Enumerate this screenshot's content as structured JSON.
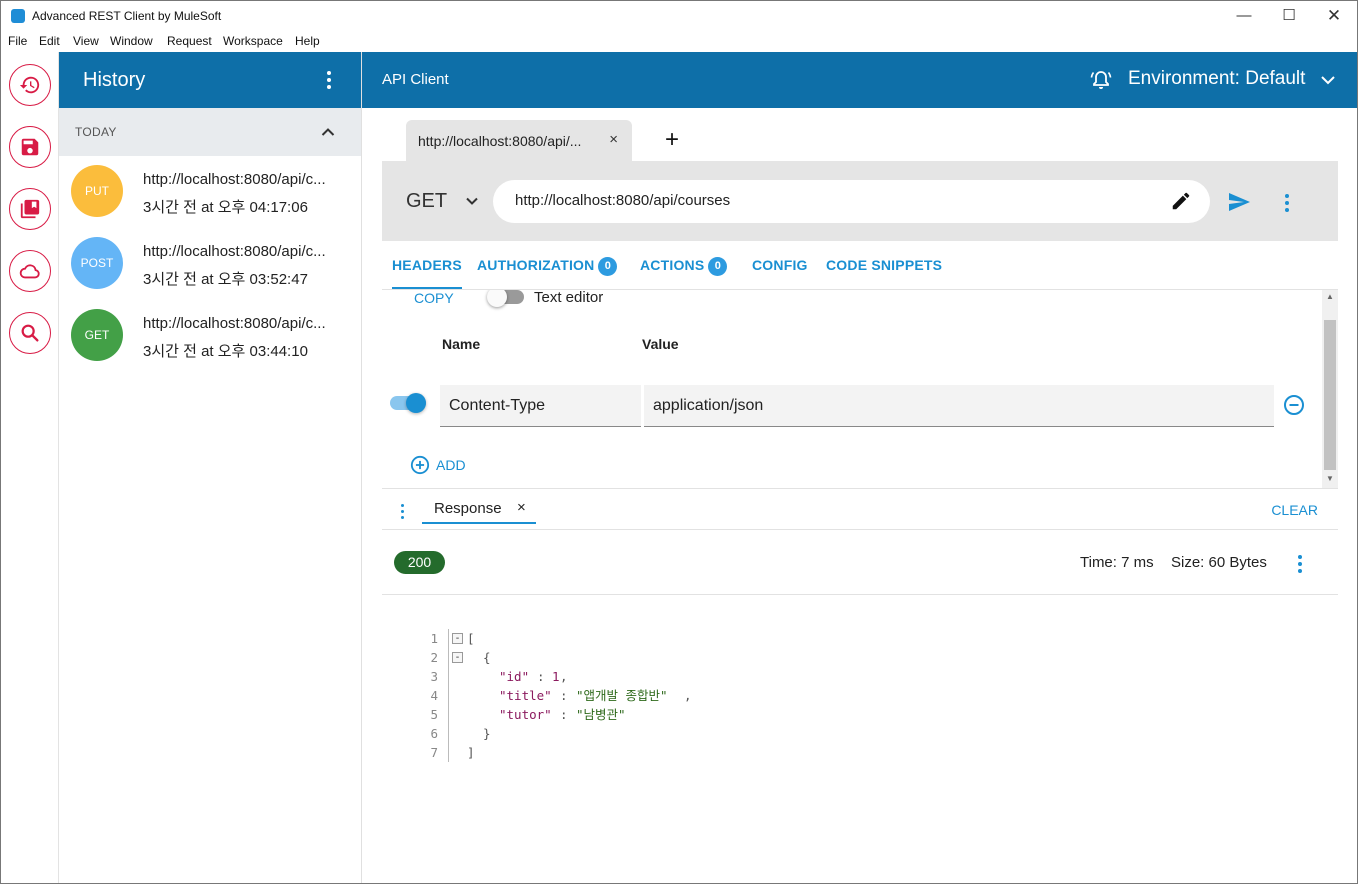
{
  "window": {
    "title": "Advanced REST Client by MuleSoft",
    "minimize": "—",
    "maximize": "☐",
    "close": "✕"
  },
  "menu": [
    "File",
    "Edit",
    "View",
    "Window",
    "Request",
    "Workspace",
    "Help"
  ],
  "rail": [
    "history-icon",
    "save-icon",
    "collections-icon",
    "cloud-icon",
    "search-icon"
  ],
  "history": {
    "title": "History",
    "group_label": "TODAY",
    "items": [
      {
        "method": "PUT",
        "color": "#fbbd3c",
        "url": "http://localhost:8080/api/c...",
        "time": "3시간 전 at 오후 04:17:06"
      },
      {
        "method": "POST",
        "color": "#64b5f6",
        "url": "http://localhost:8080/api/c...",
        "time": "3시간 전 at 오후 03:52:47"
      },
      {
        "method": "GET",
        "color": "#43a047",
        "url": "http://localhost:8080/api/c...",
        "time": "3시간 전 at 오후 03:44:10"
      }
    ]
  },
  "main": {
    "title": "API Client",
    "environment": "Environment: Default",
    "request_tab": {
      "label": "http://localhost:8080/api/...",
      "close": "×"
    },
    "add_tab": "+",
    "request": {
      "method": "GET",
      "url": "http://localhost:8080/api/courses"
    },
    "tabs": {
      "headers": "HEADERS",
      "authorization": "AUTHORIZATION",
      "authorization_count": "0",
      "actions": "ACTIONS",
      "actions_count": "0",
      "config": "CONFIG",
      "code_snippets": "CODE SNIPPETS"
    },
    "headers_editor": {
      "copy": "COPY",
      "text_editor": "Text editor",
      "col_name": "Name",
      "col_value": "Value",
      "row": {
        "name": "Content-Type",
        "value": "application/json",
        "enabled": true
      },
      "add": "ADD"
    },
    "response": {
      "tab": "Response",
      "close": "×",
      "clear": "CLEAR",
      "status": "200",
      "status_color": "#246b2c",
      "time": "Time: 7 ms",
      "size": "Size: 60 Bytes",
      "line_numbers": [
        "1",
        "2",
        "3",
        "4",
        "5",
        "6",
        "7"
      ],
      "json": {
        "open_bracket": "[",
        "open_brace": "{",
        "k_id": "\"id\"",
        "v_id": "1",
        "k_title": "\"title\"",
        "v_title": "\"앱개발 종합반\"",
        "k_tutor": "\"tutor\"",
        "v_tutor": "\"남병관\"",
        "close_brace": "}",
        "close_bracket": "]"
      }
    }
  },
  "accent": "#1a8fd2",
  "header_bg": "#0e6fa8",
  "rail_color": "#d81b45"
}
